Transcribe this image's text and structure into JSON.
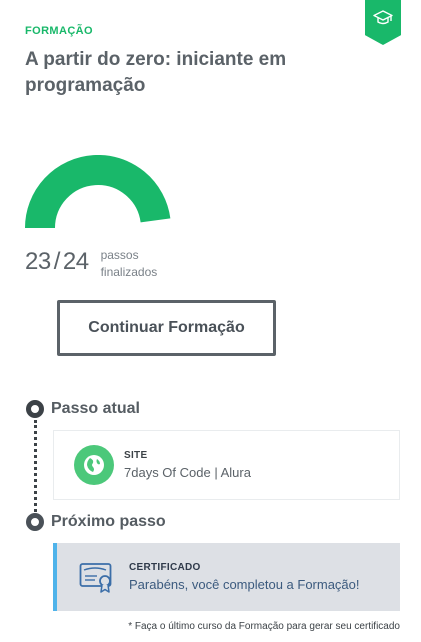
{
  "header": {
    "category": "FORMAÇÃO",
    "title": "A partir do zero: iniciante em programação",
    "badge_icon": "graduation-cap-icon"
  },
  "progress": {
    "completed": "23",
    "separator": "/",
    "total": "24",
    "caption": "passos finalizados",
    "fraction": 0.958,
    "gauge_color": "#19b86a"
  },
  "actions": {
    "continue_label": "Continuar Formação"
  },
  "timeline": {
    "current": {
      "label": "Passo atual",
      "card": {
        "type": "SITE",
        "name": "7days Of Code | Alura",
        "icon": "globe-icon",
        "icon_color": "#4cc87a"
      }
    },
    "next": {
      "label": "Próximo passo",
      "card": {
        "type": "CERTIFICADO",
        "message": "Parabéns, você completou a Formação!",
        "icon": "certificate-icon",
        "accent": "#4fb3ea"
      }
    }
  },
  "footnote": "* Faça o último curso da Formação para gerar seu certificado"
}
